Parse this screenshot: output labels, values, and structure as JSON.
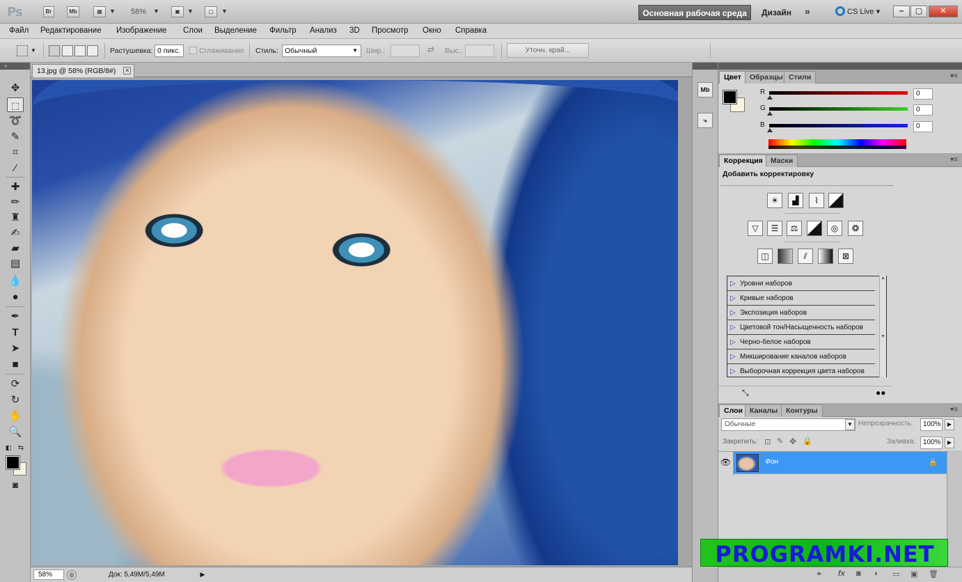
{
  "app": {
    "logo": "Ps",
    "bridge_label": "Br",
    "minibridge_label": "Mb",
    "zoom": "58%",
    "workspace_label": "Основная рабочая среда",
    "design_label": "Дизайн",
    "more_label": "»",
    "cslive_label": "CS Live"
  },
  "menu": [
    "Файл",
    "Редактирование",
    "Изображение",
    "Слои",
    "Выделение",
    "Фильтр",
    "Анализ",
    "3D",
    "Просмотр",
    "Окно",
    "Справка"
  ],
  "options": {
    "feather_label": "Растушевка:",
    "feather_value": "0 пикс.",
    "antialias_label": "Сглаживание",
    "style_label": "Стиль:",
    "style_value": "Обычный",
    "width_label": "Шир.:",
    "height_label": "Выс.:",
    "refine_label": "Уточн. край..."
  },
  "document": {
    "tab_title": "13.jpg @ 58% (RGB/8#)",
    "status_zoom": "58%",
    "status_doc": "Док: 5,49M/5,49M"
  },
  "color_panel": {
    "tabs": [
      "Цвет",
      "Образцы",
      "Стили"
    ],
    "active_tab": "Цвет",
    "foreground_color": "#000000",
    "background_color": "#f7f3dc",
    "channels": [
      {
        "label": "R",
        "value": "0",
        "color": "#d11f1f"
      },
      {
        "label": "G",
        "value": "0",
        "color": "#3bb12a"
      },
      {
        "label": "B",
        "value": "0",
        "color": "#1f2fd1"
      }
    ]
  },
  "adjustments_panel": {
    "tabs": [
      "Коррекция",
      "Маски"
    ],
    "active_tab": "Коррекция",
    "title": "Добавить корректировку",
    "presets": [
      "Уровни наборов",
      "Кривые наборов",
      "Экспозиция наборов",
      "Цветовой тон/Насыщенность наборов",
      "Черно-белое наборов",
      "Микширование каналов наборов",
      "Выборочная коррекция цвета наборов"
    ]
  },
  "layers_panel": {
    "tabs": [
      "Слои",
      "Каналы",
      "Контуры"
    ],
    "active_tab": "Слои",
    "blend_mode": "Обычные",
    "opacity_label": "Непрозрачность:",
    "opacity_value": "100%",
    "lock_label": "Закрепить:",
    "fill_label": "Заливка:",
    "fill_value": "100%",
    "layers": [
      {
        "name": "Фон",
        "locked": true,
        "visible": true
      }
    ]
  },
  "watermark": "PROGRAMKI.NET"
}
